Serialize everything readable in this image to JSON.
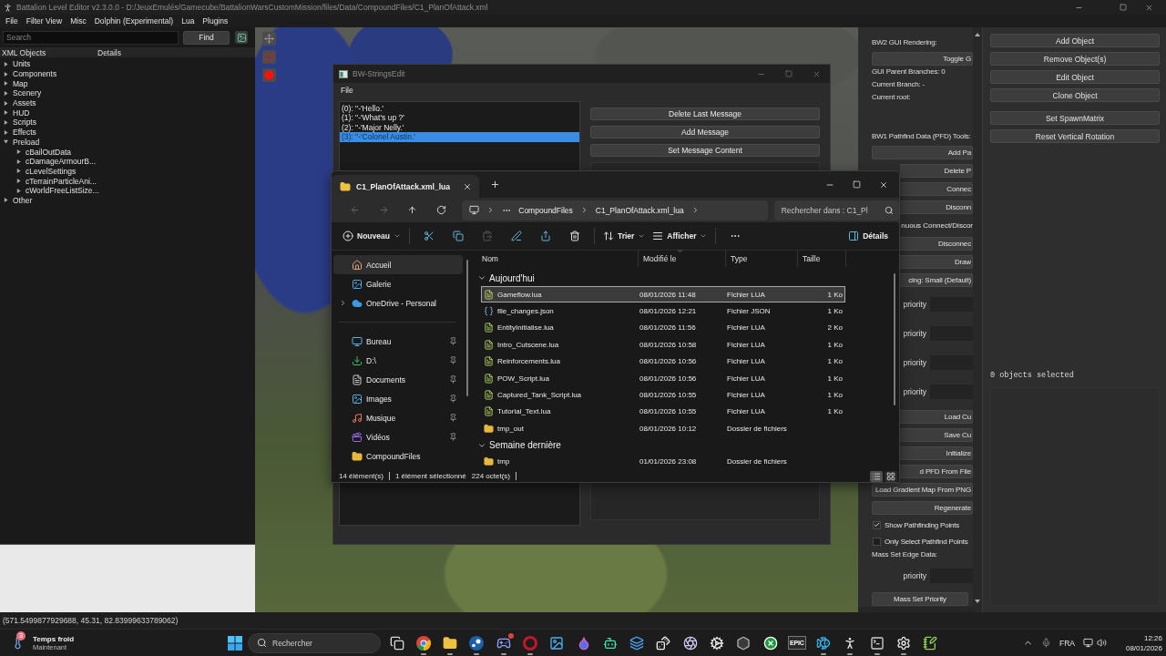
{
  "app_window": {
    "title": "Battalion Level Editor v2.3.0.0 - D:/JeuxEmulés/Gamecube/BattalionWarsCustomMission/files/Data/CompoundFiles/C1_PlanOfAttack.xml",
    "menu": [
      "File",
      "Filter View",
      "Misc",
      "Dolphin (Experimental)",
      "Lua",
      "Plugins"
    ]
  },
  "search": {
    "placeholder": "Search",
    "button": "Find"
  },
  "tree": {
    "columns": [
      "XML Objects",
      "Details"
    ],
    "items": [
      {
        "label": "Units",
        "expanded": false
      },
      {
        "label": "Components",
        "expanded": false
      },
      {
        "label": "Map",
        "expanded": false
      },
      {
        "label": "Scenery",
        "expanded": false
      },
      {
        "label": "Assets",
        "expanded": false
      },
      {
        "label": "HUD",
        "expanded": false
      },
      {
        "label": "Scripts",
        "expanded": false
      },
      {
        "label": "Effects",
        "expanded": false
      },
      {
        "label": "Preload",
        "expanded": true,
        "children": [
          {
            "label": "cBailOutData",
            "expanded": false
          },
          {
            "label": "cDamageArmourB...",
            "expanded": false
          },
          {
            "label": "cLevelSettings",
            "expanded": false
          },
          {
            "label": "cTerrainParticleAni...",
            "expanded": false
          },
          {
            "label": "cWorldFreeListSize...",
            "expanded": false
          }
        ]
      },
      {
        "label": "Other",
        "expanded": false
      }
    ]
  },
  "strings_window": {
    "title": "BW-StringsEdit",
    "menu": [
      "File"
    ],
    "messages": [
      {
        "text": "(0): \"-'Hello.'",
        "selected": false
      },
      {
        "text": "(1): \"-'What's up ?'",
        "selected": false
      },
      {
        "text": "(2): \"-'Major Nelly.'",
        "selected": false
      },
      {
        "text": "(3): \"-'Colonel Austin.'",
        "selected": true
      }
    ],
    "buttons": [
      "Delete Last Message",
      "Add Message",
      "Set Message Content"
    ]
  },
  "explorer": {
    "tab": "C1_PlanOfAttack.xml_lua",
    "breadcrumb": [
      "CompoundFiles",
      "C1_PlanOfAttack.xml_lua"
    ],
    "search_placeholder": "Rechercher dans : C1_Pl",
    "commands": [
      {
        "kind": "new",
        "label": "Nouveau",
        "disabled": false
      },
      {
        "kind": "cut",
        "disabled": false
      },
      {
        "kind": "copy",
        "disabled": false
      },
      {
        "kind": "paste",
        "disabled": true
      },
      {
        "kind": "rename",
        "disabled": false
      },
      {
        "kind": "share",
        "disabled": false
      },
      {
        "kind": "delete",
        "disabled": false
      },
      {
        "kind": "sort",
        "label": "Trier",
        "disabled": false
      },
      {
        "kind": "view",
        "label": "Afficher",
        "disabled": false
      },
      {
        "kind": "more",
        "disabled": false
      }
    ],
    "details_button": "Détails",
    "nav_sections": [
      [
        {
          "label": "Accueil",
          "kind": "home",
          "selected": true,
          "pinned": false
        },
        {
          "label": "Galerie",
          "kind": "gallery",
          "selected": false,
          "pinned": false
        },
        {
          "label": "OneDrive - Personal",
          "kind": "cloud",
          "selected": false,
          "pinned": false,
          "expanded": false
        }
      ],
      [
        {
          "label": "Bureau",
          "kind": "desktop",
          "selected": false,
          "pinned": true
        },
        {
          "label": "D:\\",
          "kind": "download",
          "selected": false,
          "pinned": true
        },
        {
          "label": "Documents",
          "kind": "document",
          "selected": false,
          "pinned": true
        },
        {
          "label": "Images",
          "kind": "images",
          "selected": false,
          "pinned": true
        },
        {
          "label": "Musique",
          "kind": "music",
          "selected": false,
          "pinned": true
        },
        {
          "label": "Vidéos",
          "kind": "video",
          "selected": false,
          "pinned": true
        },
        {
          "label": "CompoundFiles",
          "kind": "folder",
          "selected": false,
          "pinned": false
        }
      ]
    ],
    "columns": [
      {
        "label": "Nom",
        "sorted": false
      },
      {
        "label": "Modifié le",
        "sorted": true
      },
      {
        "label": "Type",
        "sorted": false
      },
      {
        "label": "Taille",
        "sorted": false
      }
    ],
    "groups": [
      {
        "label": "Aujourd'hui",
        "expanded": true,
        "rows": [
          {
            "name": "Gameflow.lua",
            "kind": "lua",
            "modified": "08/01/2026 11:48",
            "type": "Fichier LUA",
            "size": "1 Ko",
            "selected": true
          },
          {
            "name": "file_changes.json",
            "kind": "json",
            "modified": "08/01/2026 12:21",
            "type": "Fichier JSON",
            "size": "1 Ko",
            "selected": false
          },
          {
            "name": "EntityInitialise.lua",
            "kind": "lua",
            "modified": "08/01/2026 11:56",
            "type": "Fichier LUA",
            "size": "2 Ko",
            "selected": false
          },
          {
            "name": "Intro_Cutscene.lua",
            "kind": "lua",
            "modified": "08/01/2026 10:58",
            "type": "Fichier LUA",
            "size": "1 Ko",
            "selected": false
          },
          {
            "name": "Reinforcements.lua",
            "kind": "lua",
            "modified": "08/01/2026 10:56",
            "type": "Fichier LUA",
            "size": "1 Ko",
            "selected": false
          },
          {
            "name": "POW_Script.lua",
            "kind": "lua",
            "modified": "08/01/2026 10:56",
            "type": "Fichier LUA",
            "size": "1 Ko",
            "selected": false
          },
          {
            "name": "Captured_Tank_Script.lua",
            "kind": "lua",
            "modified": "08/01/2026 10:55",
            "type": "Fichier LUA",
            "size": "1 Ko",
            "selected": false
          },
          {
            "name": "Tutorial_Text.lua",
            "kind": "lua",
            "modified": "08/01/2026 10:55",
            "type": "Fichier LUA",
            "size": "1 Ko",
            "selected": false
          },
          {
            "name": "tmp_out",
            "kind": "folder",
            "modified": "08/01/2026 10:12",
            "type": "Dossier de fichiers",
            "selected": false
          }
        ]
      },
      {
        "label": "Semaine dernière",
        "expanded": true,
        "rows": [
          {
            "name": "tmp",
            "kind": "folder",
            "modified": "01/01/2026 23:08",
            "type": "Dossier de fichiers",
            "selected": false
          }
        ]
      }
    ],
    "status": [
      "14 élément(s)",
      "1 élément sélectionné",
      "224 octet(s)"
    ],
    "views": [
      {
        "kind": "details",
        "selected": true
      },
      {
        "kind": "tiles",
        "selected": false
      }
    ]
  },
  "tools_panel": {
    "items": [
      {
        "kind": "heading",
        "text": "BW2 GUI Rendering:"
      },
      {
        "kind": "cut_button",
        "text": "Toggle G"
      },
      {
        "kind": "info",
        "text": "GUI Parent Branches: 0"
      },
      {
        "kind": "info",
        "text": "Current Branch: -"
      },
      {
        "kind": "info",
        "text": "Current root:"
      },
      {
        "kind": "heading",
        "text": "BW1 Pathfind Data (PFD) Tools:"
      },
      {
        "kind": "cut_button",
        "text": "Add Pa"
      },
      {
        "kind": "cut_button",
        "text": "Delete P"
      },
      {
        "kind": "cut_button",
        "text": "Connec"
      },
      {
        "kind": "cut_button",
        "text": "Disconn"
      },
      {
        "kind": "cut_text",
        "text": "nuous Connect/Discor"
      },
      {
        "kind": "cut_button",
        "text": "Disconnec"
      },
      {
        "kind": "cut_button",
        "text": "Draw"
      },
      {
        "kind": "cut_button",
        "text": "cing: Small (Default)"
      },
      {
        "kind": "field",
        "label": "priority"
      },
      {
        "kind": "field",
        "label": "priority"
      },
      {
        "kind": "field",
        "label": "priority"
      },
      {
        "kind": "field",
        "label": "priority"
      },
      {
        "kind": "cut_button",
        "text": "Load Cu"
      },
      {
        "kind": "cut_button",
        "text": "Save Cu"
      },
      {
        "kind": "cut_button",
        "text": "Initialize"
      },
      {
        "kind": "cut_button",
        "text": "d PFD From File"
      },
      {
        "kind": "cut_button",
        "text": "Load Gradient Map From PNG"
      },
      {
        "kind": "cut_button",
        "text": "Regenerate"
      },
      {
        "kind": "checkbox",
        "text": "Show Pathfinding Points",
        "checked": true
      },
      {
        "kind": "checkbox",
        "text": "Only Select Pathfind Points",
        "checked": false
      },
      {
        "kind": "heading",
        "text": "Mass Set Edge Data:"
      },
      {
        "kind": "field",
        "label": "priority"
      },
      {
        "kind": "button",
        "text": "Mass Set Priority"
      }
    ]
  },
  "object_panel": {
    "button_groups": [
      [
        "Add Object",
        "Remove Object(s)",
        "Edit Object",
        "Clone Object"
      ],
      [
        "Set SpawnMatrix",
        "Reset Vertical Rotation"
      ]
    ],
    "selection": "0 objects selected"
  },
  "status_bar": "(571.5499877929688, 45.31, 82.83999633789062)",
  "taskbar": {
    "weather": {
      "title": "Temps froid",
      "subtitle": "Maintenant",
      "badge": "3"
    },
    "search_placeholder": "Rechercher",
    "apps": [
      {
        "kind": "task_view",
        "running": false,
        "badge": false
      },
      {
        "kind": "browser",
        "running": true,
        "badge": false
      },
      {
        "kind": "folder",
        "running": true,
        "badge": false
      },
      {
        "kind": "disc",
        "running": true,
        "badge": false
      },
      {
        "kind": "controller",
        "running": true,
        "badge": true
      },
      {
        "kind": "ring",
        "running": true,
        "badge": false
      },
      {
        "kind": "image",
        "running": false,
        "badge": false
      },
      {
        "kind": "droplet",
        "running": false,
        "badge": false
      },
      {
        "kind": "bot",
        "running": false,
        "badge": false
      },
      {
        "kind": "layers",
        "running": false,
        "badge": false
      },
      {
        "kind": "dice",
        "running": false,
        "badge": false
      },
      {
        "kind": "aperture",
        "running": false,
        "badge": false
      },
      {
        "kind": "cog",
        "running": false,
        "badge": false
      },
      {
        "kind": "hexagon",
        "running": false,
        "badge": false
      },
      {
        "kind": "xcircle",
        "running": false,
        "badge": false
      },
      {
        "kind": "logo",
        "label": "EPIC",
        "running": false,
        "badge": false
      },
      {
        "kind": "fish",
        "running": true,
        "badge": false
      },
      {
        "kind": "person",
        "running": true,
        "badge": false
      },
      {
        "kind": "terminal",
        "running": true,
        "badge": false
      },
      {
        "kind": "settings",
        "running": true,
        "badge": false
      },
      {
        "kind": "notepad",
        "running": false,
        "badge": false
      }
    ],
    "language": "FRA",
    "time": "12:26",
    "date": "08/01/2026"
  }
}
